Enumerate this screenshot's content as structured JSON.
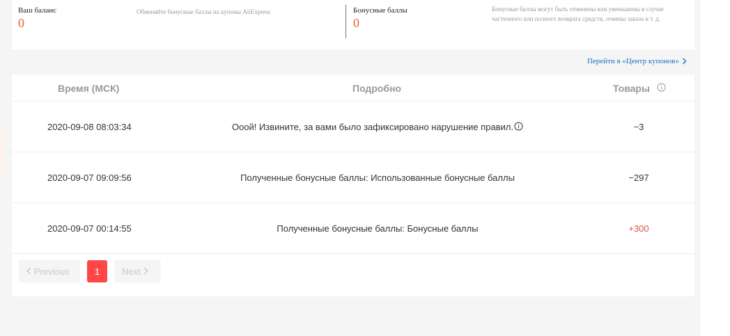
{
  "balance": {
    "your_balance_label": "Ваш баланс",
    "your_balance_value": "0",
    "exchange_note": "Обменяйте бонусные баллы на купоны AliExpress",
    "bonus_points_label": "Бонусные баллы",
    "bonus_points_value": "0",
    "bonus_note_line1": "Бонусные баллы могут быть отменены или уменьшены в случае",
    "bonus_note_line2": "частичного или полного возврата средств, отмены заказа и т. д."
  },
  "coupon_center": {
    "link_label": "Перейти в «Центр купонов»"
  },
  "table": {
    "headers": {
      "time": "Время (МСК)",
      "details": "Подробно",
      "goods": "Товары"
    },
    "rows": [
      {
        "time": "2020-09-08 08:03:34",
        "detail": "Ооой! Извините, за вами было зафиксировано нарушение правил.",
        "amount": "−3"
      },
      {
        "time": "2020-09-07 09:09:56",
        "detail": "Полученные бонусные баллы: Использованные бонусные баллы",
        "amount": "−297"
      },
      {
        "time": "2020-09-07 00:14:55",
        "detail": "Полученные бонусные баллы: Бонусные баллы",
        "amount": "+300"
      }
    ]
  },
  "pagination": {
    "previous_label": "Previous",
    "current_page": "1",
    "next_label": "Next"
  },
  "colors": {
    "accent_orange": "#e8632b",
    "link_blue": "#1a6fc4",
    "active_page_red": "#ff4747",
    "positive_red": "#d9534f"
  },
  "icons": {
    "info": "info-circle-icon",
    "chevron_right": "chevron-right-icon",
    "chevron_left": "chevron-left-icon"
  }
}
